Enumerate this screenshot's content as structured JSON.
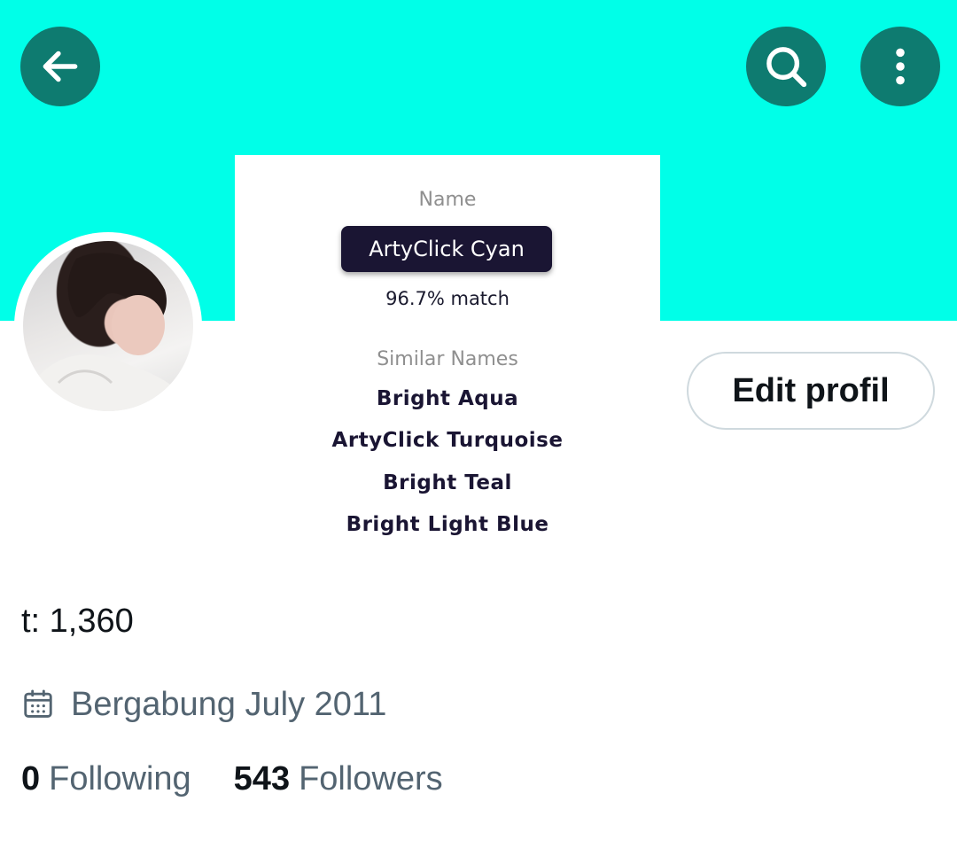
{
  "header": {
    "back_icon": "arrow-left-icon",
    "search_icon": "search-icon",
    "more_icon": "more-vertical-icon",
    "banner_color": "#00ffe8",
    "button_color": "#0e7b70"
  },
  "color_card": {
    "name_label": "Name",
    "color_name": "ArtyClick Cyan",
    "match_text": "96.7% match",
    "similar_label": "Similar Names",
    "similar_names": [
      "Bright Aqua",
      "ArtyClick Turquoise",
      "Bright Teal",
      "Bright Light Blue"
    ]
  },
  "profile": {
    "edit_button": "Edit profil",
    "partial_text": "t: 1,360",
    "joined_text": "Bergabung July 2011",
    "calendar_icon": "calendar-icon",
    "following_count": "0",
    "following_label": "Following",
    "followers_count": "543",
    "followers_label": "Followers"
  }
}
